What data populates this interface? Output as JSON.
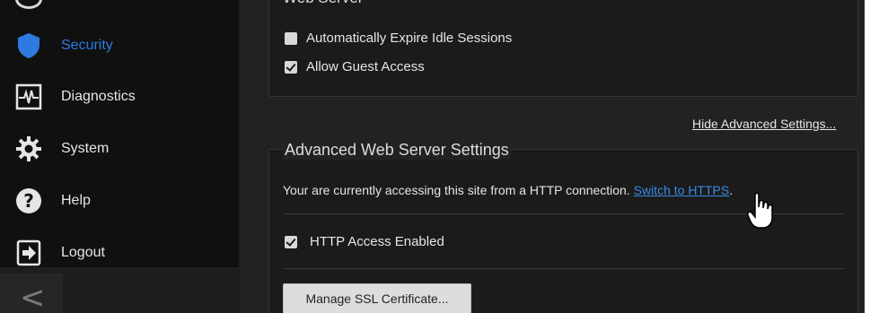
{
  "sidebar": {
    "items": [
      {
        "label": "Security",
        "icon": "shield-icon",
        "active": true
      },
      {
        "label": "Diagnostics",
        "icon": "pulse-icon",
        "active": false
      },
      {
        "label": "System",
        "icon": "gear-icon",
        "active": false
      },
      {
        "label": "Help",
        "icon": "question-icon",
        "active": false
      },
      {
        "label": "Logout",
        "icon": "logout-icon",
        "active": false
      }
    ],
    "collapse_label": "<"
  },
  "web_server": {
    "title": "Web Server",
    "expire_sessions": {
      "label": "Automatically Expire Idle Sessions",
      "checked": false
    },
    "guest_access": {
      "label": "Allow Guest Access",
      "checked": true
    }
  },
  "hide_advanced_label": "Hide Advanced Settings...",
  "advanced": {
    "title": "Advanced Web Server Settings",
    "info_text": "Your are currently accessing this site from a HTTP connection. ",
    "https_link": "Switch to HTTPS",
    "info_suffix": ".",
    "http_access": {
      "label": "HTTP Access Enabled",
      "checked": true
    },
    "ssl_button": "Manage SSL Certificate..."
  },
  "colors": {
    "accent": "#2d7ae0",
    "link": "#3b8ae8",
    "sidebar_bg": "#101010",
    "main_bg": "#222222"
  }
}
